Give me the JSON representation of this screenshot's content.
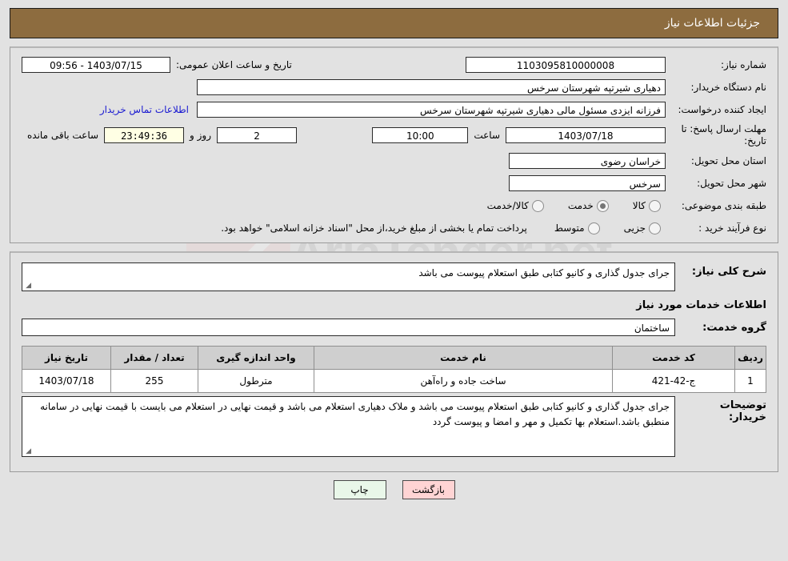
{
  "header": {
    "title": "جزئیات اطلاعات نیاز"
  },
  "top_form": {
    "need_number": {
      "label": "شماره نیاز:",
      "value": "1103095810000008"
    },
    "public_announce": {
      "label": "تاریخ و ساعت اعلان عمومی:",
      "value": "1403/07/15 - 09:56"
    },
    "buyer_org": {
      "label": "نام دستگاه خریدار:",
      "value": "دهیاری شیرتپه شهرستان سرخس"
    },
    "request_creator": {
      "label": "ایجاد کننده درخواست:",
      "value": "فرزانه ایزدی مسئول مالی دهیاری شیرتپه شهرستان سرخس"
    },
    "buyer_contact_link": "اطلاعات تماس خریدار",
    "response_deadline": {
      "label": "مهلت ارسال پاسخ: تا تاریخ:",
      "date": "1403/07/18",
      "time_label": "ساعت",
      "time": "10:00",
      "days": "2",
      "days_label": "روز و",
      "timer": "23:49:36",
      "timer_suffix": "ساعت باقی مانده"
    },
    "delivery_province": {
      "label": "استان محل تحویل:",
      "value": "خراسان رضوی"
    },
    "delivery_city": {
      "label": "شهر محل تحویل:",
      "value": "سرخس"
    },
    "subject_category": {
      "label": "طبقه بندی موضوعی:",
      "options": [
        "کالا",
        "خدمت",
        "کالا/خدمت"
      ],
      "selected": "خدمت"
    },
    "purchase_process": {
      "label": "نوع فرآیند خرید :",
      "options": [
        "جزیی",
        "متوسط"
      ],
      "selected": "",
      "note": "پرداخت تمام یا بخشی از مبلغ خرید،از محل \"اسناد خزانه اسلامی\" خواهد بود."
    }
  },
  "middle": {
    "general_desc_label": "شرح کلی نیاز:",
    "general_desc_value": "جرای جدول گذاری و کانیو کتابی  طبق استعلام پیوست می باشد",
    "services_section_title": "اطلاعات خدمات مورد نیاز",
    "service_group_label": "گروه خدمت:",
    "service_group_value": "ساختمان",
    "buyer_notes_label": "توضیحات خریدار:",
    "buyer_notes_value": "جرای جدول گذاری و کانیو کتابی  طبق استعلام پیوست می باشد و ملاک دهیاری استعلام می باشد و قیمت نهایی در استعلام می بایست با قیمت نهایی در سامانه منطبق باشد.استعلام بها تکمیل و مهر و امضا و پیوست گردد"
  },
  "table": {
    "headers": [
      "ردیف",
      "کد خدمت",
      "نام خدمت",
      "واحد اندازه گیری",
      "تعداد / مقدار",
      "تاریخ نیاز"
    ],
    "rows": [
      {
        "row": "1",
        "code": "ج-42-421",
        "name": "ساخت جاده و راه‌آهن",
        "unit": "مترطول",
        "qty": "255",
        "date": "1403/07/18"
      }
    ]
  },
  "footer": {
    "print_label": "چاپ",
    "back_label": "بازگشت"
  },
  "watermark": {
    "text": "AriaTender.net"
  },
  "colors": {
    "header_brown": "#8d6c3f",
    "page_bg": "#e2e2e2",
    "link_blue": "#1919d1",
    "timer_bg": "#ffffe4",
    "back_btn": "#ffd4d4",
    "print_btn": "#e9f7e9",
    "table_header": "#cfcfcf"
  }
}
